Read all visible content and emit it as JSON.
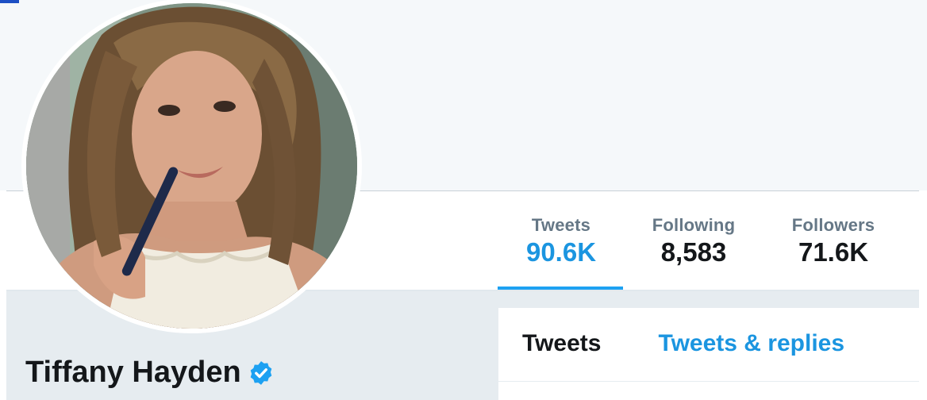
{
  "profile": {
    "display_name": "Tiffany Hayden",
    "verified": true
  },
  "stats": [
    {
      "label": "Tweets",
      "value": "90.6K",
      "active": true
    },
    {
      "label": "Following",
      "value": "8,583",
      "active": false
    },
    {
      "label": "Followers",
      "value": "71.6K",
      "active": false
    }
  ],
  "tabs": [
    {
      "label": "Tweets",
      "active": true
    },
    {
      "label": "Tweets & replies",
      "active": false
    }
  ],
  "colors": {
    "accent": "#1da1f2",
    "link": "#1b95e0",
    "text": "#14171a",
    "muted": "#657786"
  }
}
